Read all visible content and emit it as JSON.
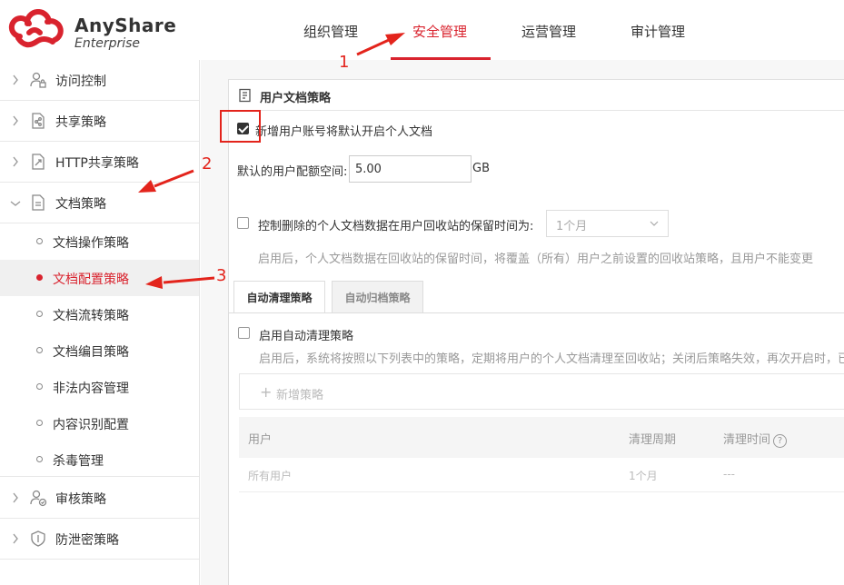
{
  "brand": {
    "name": "AnyShare",
    "edition": "Enterprise",
    "color": "#d9232e"
  },
  "topnav": [
    {
      "label": "组织管理",
      "active": false
    },
    {
      "label": "安全管理",
      "active": true
    },
    {
      "label": "运营管理",
      "active": false
    },
    {
      "label": "审计管理",
      "active": false
    }
  ],
  "sidebar": {
    "groups": [
      {
        "label": "访问控制",
        "icon": "user-lock-icon",
        "expanded": false
      },
      {
        "label": "共享策略",
        "icon": "share-doc-icon",
        "expanded": false
      },
      {
        "label": "HTTP共享策略",
        "icon": "http-share-icon",
        "expanded": false
      },
      {
        "label": "文档策略",
        "icon": "document-icon",
        "expanded": true
      },
      {
        "label": "审核策略",
        "icon": "user-check-icon",
        "expanded": false
      },
      {
        "label": "防泄密策略",
        "icon": "shield-icon",
        "expanded": false
      }
    ],
    "doc_sub_items": [
      {
        "label": "文档操作策略",
        "active": false
      },
      {
        "label": "文档配置策略",
        "active": true
      },
      {
        "label": "文档流转策略",
        "active": false
      },
      {
        "label": "文档编目策略",
        "active": false
      },
      {
        "label": "非法内容管理",
        "active": false
      },
      {
        "label": "内容识别配置",
        "active": false
      },
      {
        "label": "杀毒管理",
        "active": false
      }
    ]
  },
  "panel": {
    "title": "用户文档策略",
    "auto_create": {
      "label": "新增用户账号将默认开启个人文档",
      "checked": true
    },
    "quota": {
      "label": "默认的用户配额空间:",
      "value": "5.00",
      "unit": "GB"
    },
    "retention": {
      "label": "控制删除的个人文档数据在用户回收站的保留时间为:",
      "checked": false,
      "selected": "1个月",
      "hint": "启用后，个人文档数据在回收站的保留时间，将覆盖（所有）用户之前设置的回收站策略，且用户不能变更"
    },
    "tabs": [
      {
        "label": "自动清理策略",
        "active": true
      },
      {
        "label": "自动归档策略",
        "active": false
      }
    ],
    "auto_clean": {
      "enable_label": "启用自动清理策略",
      "checked": false,
      "hint": "启用后，系统将按照以下列表中的策略，定期将用户的个人文档清理至回收站；关闭后策略失效，再次开启时，已",
      "add_label": "新增策略",
      "columns": [
        "用户",
        "清理周期",
        "清理时间"
      ],
      "help_icon": "?",
      "rows": [
        [
          "所有用户",
          "1个月",
          "---"
        ]
      ]
    }
  },
  "annotations": {
    "labels": [
      "1",
      "2",
      "3"
    ],
    "color": "#e3241c"
  }
}
